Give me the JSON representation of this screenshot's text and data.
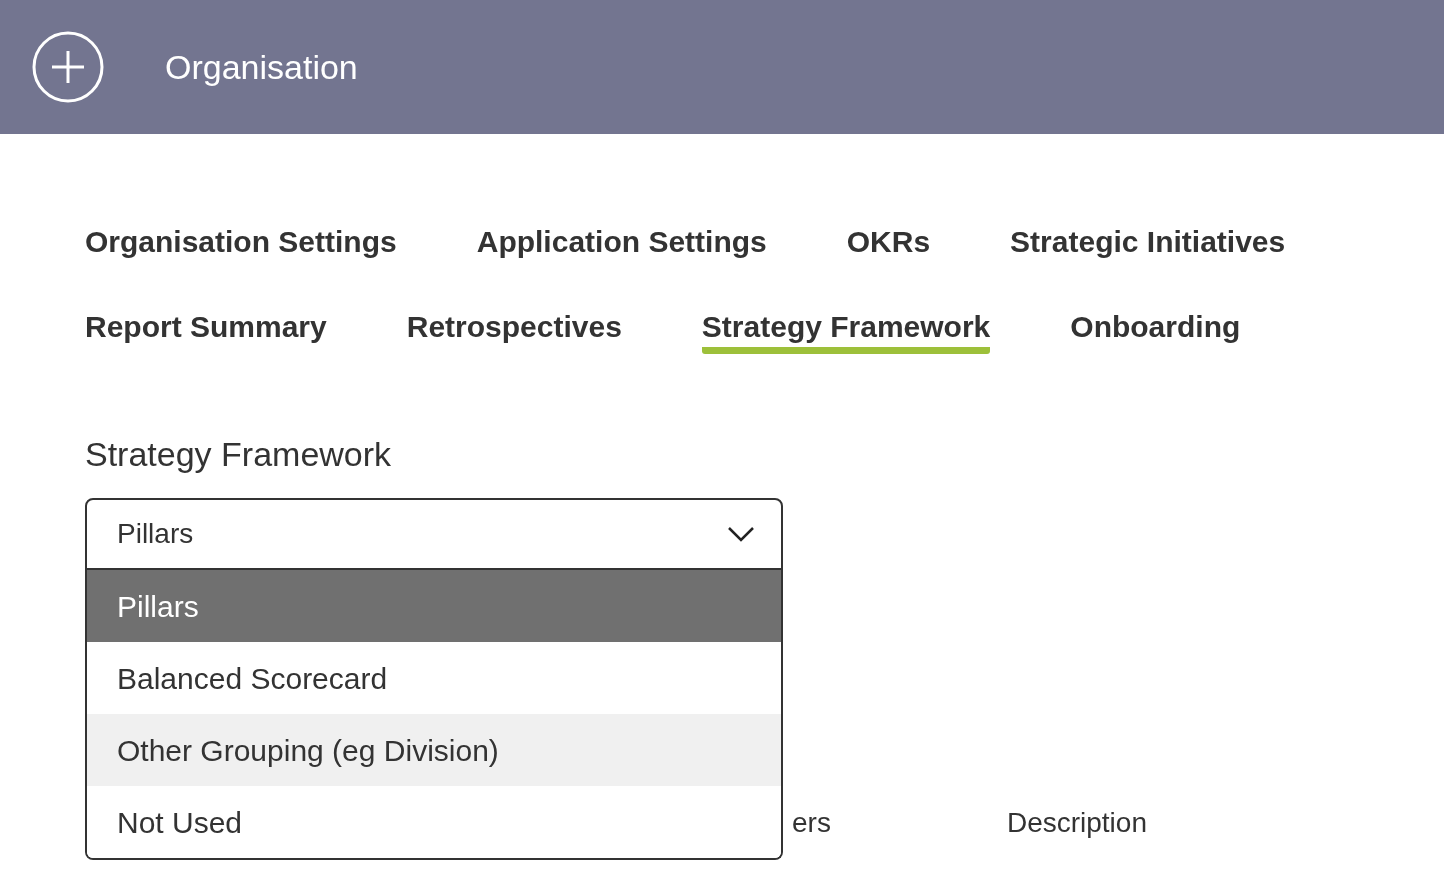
{
  "header": {
    "title": "Organisation"
  },
  "tab_rows": [
    [
      {
        "label": "Organisation Settings",
        "selected": false
      },
      {
        "label": "Application Settings",
        "selected": false
      },
      {
        "label": "OKRs",
        "selected": false
      },
      {
        "label": "Strategic Initiatives",
        "selected": false
      }
    ],
    [
      {
        "label": "Report Summary",
        "selected": false
      },
      {
        "label": "Retrospectives",
        "selected": false
      },
      {
        "label": "Strategy Framework",
        "selected": true
      },
      {
        "label": "Onboarding",
        "selected": false
      }
    ]
  ],
  "section": {
    "title": "Strategy Framework"
  },
  "dropdown": {
    "value": "Pillars",
    "expanded": true,
    "options": [
      {
        "label": "Pillars",
        "selected": true,
        "highlighted": false
      },
      {
        "label": "Balanced Scorecard",
        "selected": false,
        "highlighted": false
      },
      {
        "label": "Other Grouping (eg Division)",
        "selected": false,
        "highlighted": true
      },
      {
        "label": "Not Used",
        "selected": false,
        "highlighted": false
      }
    ]
  },
  "table": {
    "columns": [
      "ers",
      "Description"
    ]
  }
}
